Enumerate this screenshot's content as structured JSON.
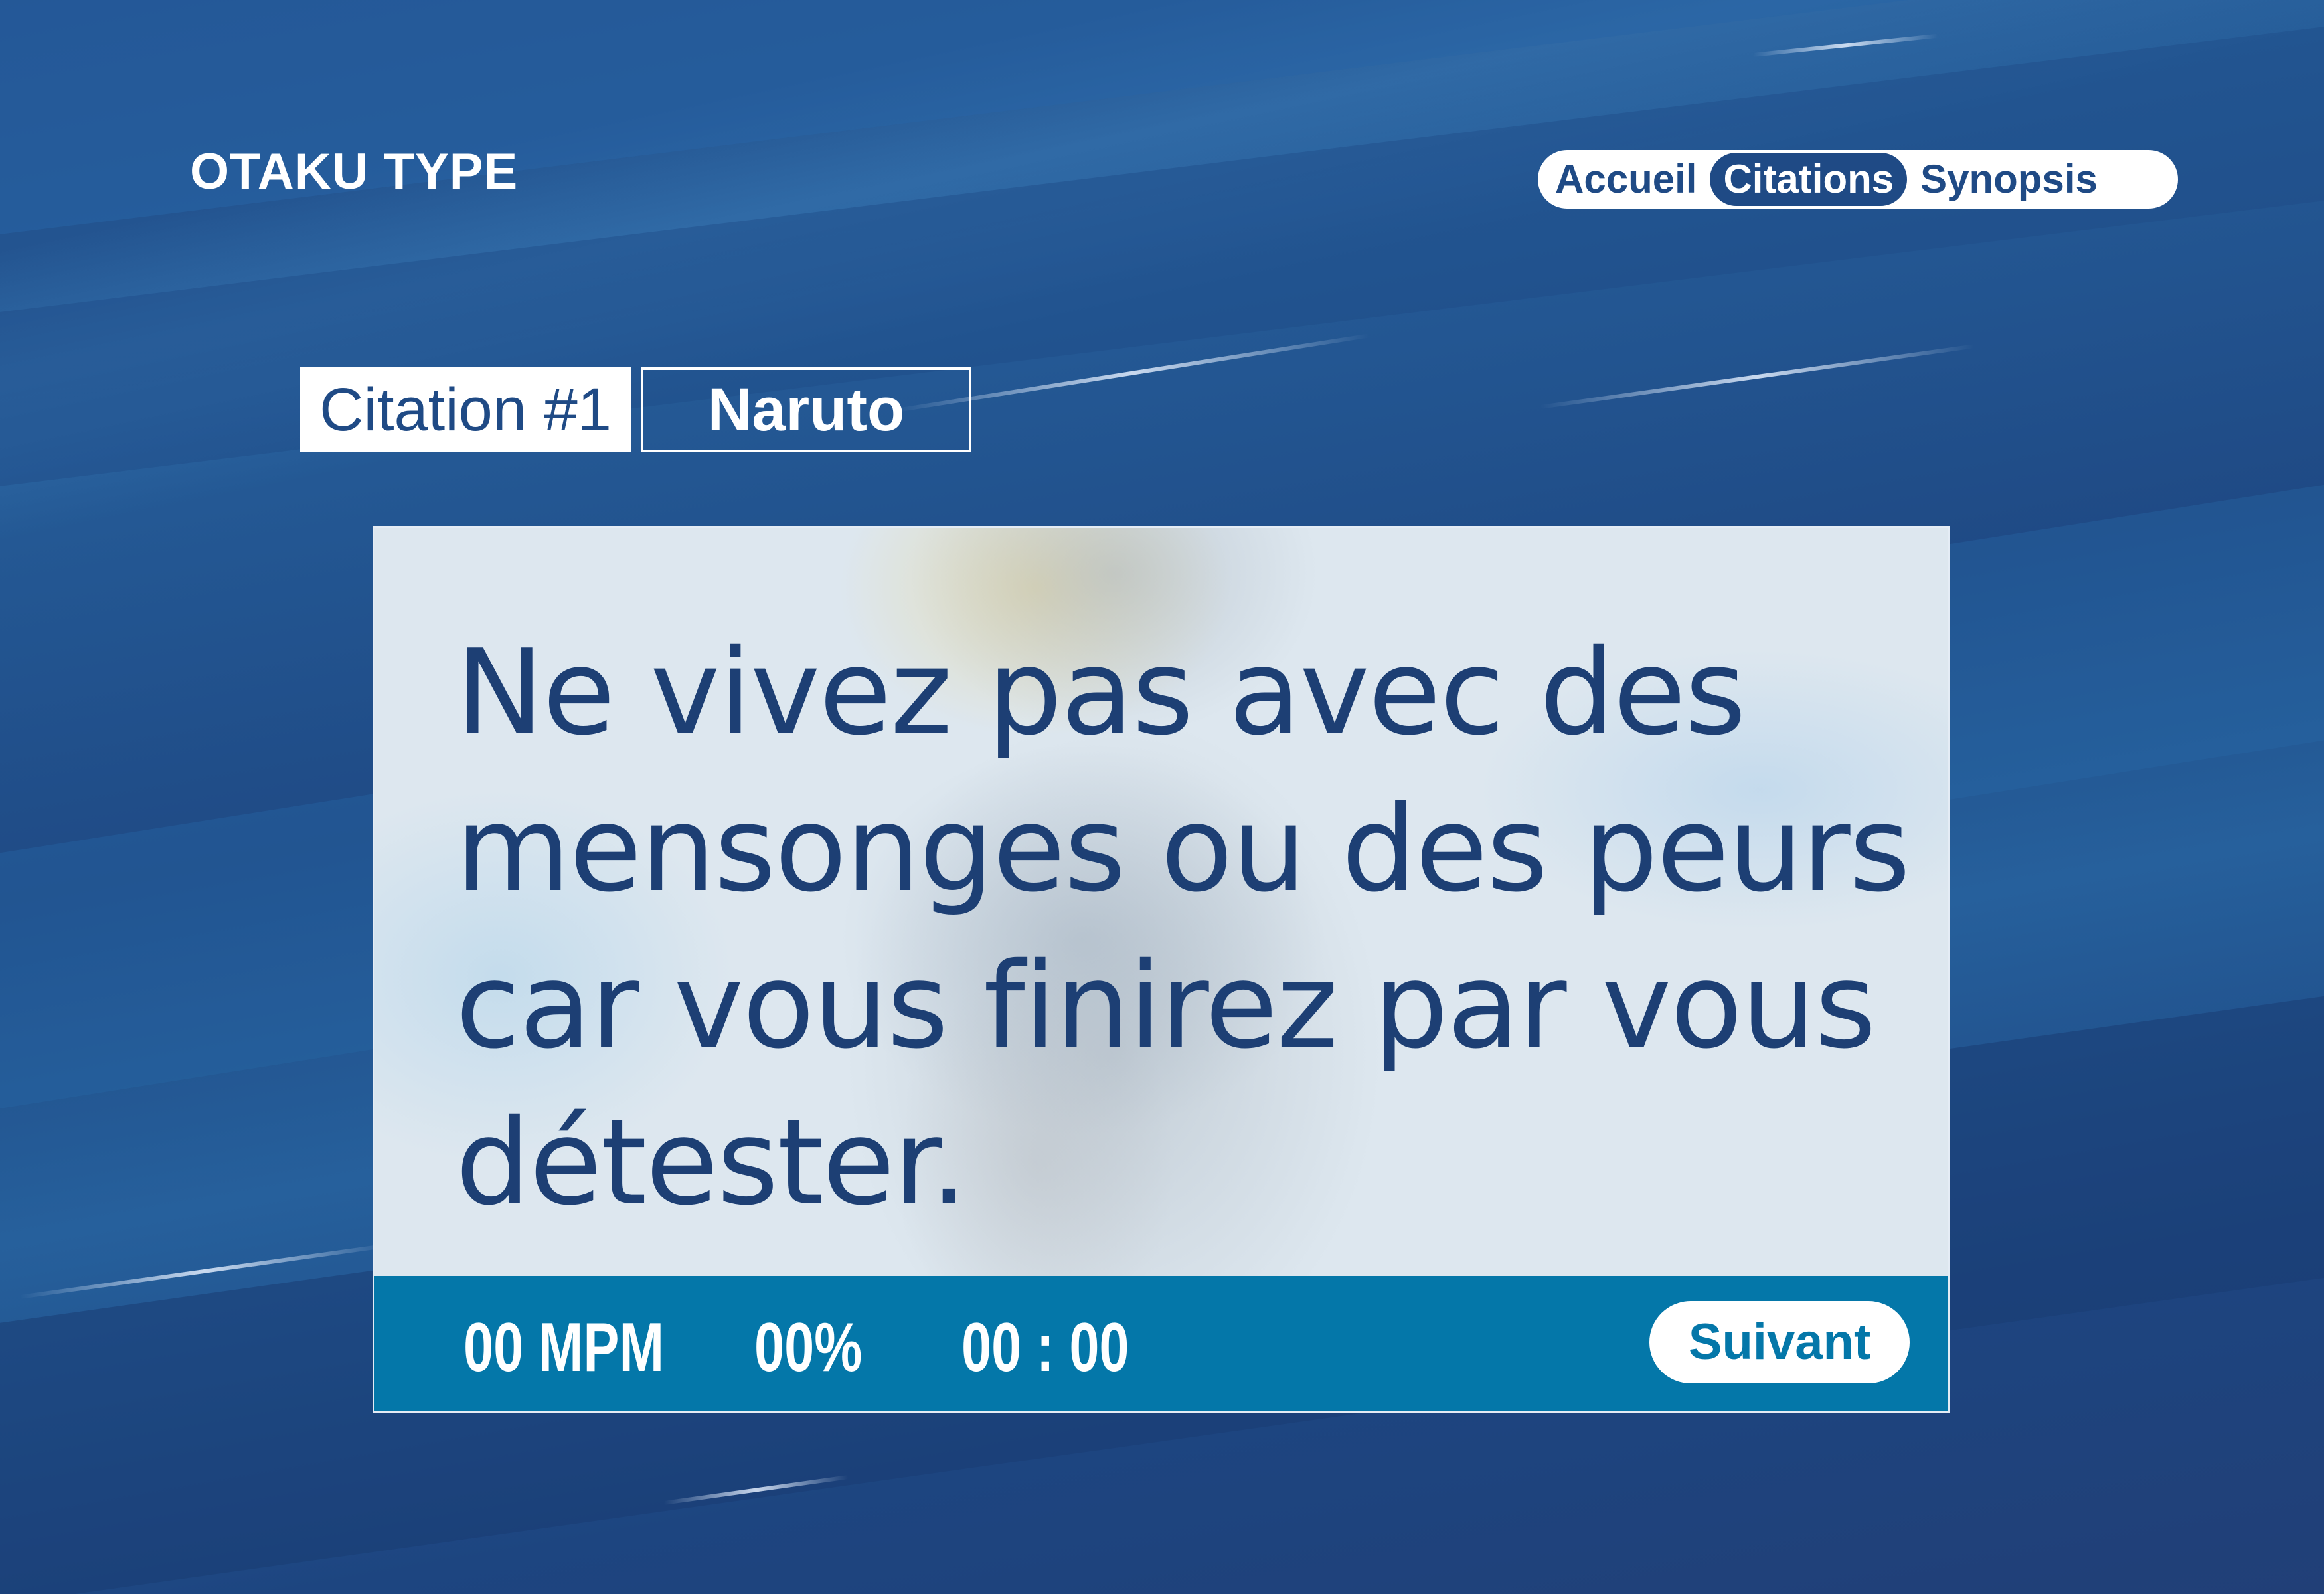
{
  "app": {
    "logo": "OTAKU TYPE"
  },
  "nav": {
    "items": [
      {
        "label": "Accueil",
        "active": false
      },
      {
        "label": "Citations",
        "active": true
      },
      {
        "label": "Synopsis",
        "active": false
      }
    ]
  },
  "quote_meta": {
    "number_label": "Citation #1",
    "anime": "Naruto"
  },
  "quote": {
    "text": "Ne vivez pas avec des mensonges ou des peurs car vous finirez par vous détester."
  },
  "stats": {
    "wpm": "00 MPM",
    "accuracy": "00%",
    "timer": "00 : 00"
  },
  "actions": {
    "next_label": "Suivant"
  },
  "colors": {
    "background": "#1f4a85",
    "accent": "#0477a9",
    "text_dark": "#1d3f74",
    "white": "#ffffff"
  }
}
